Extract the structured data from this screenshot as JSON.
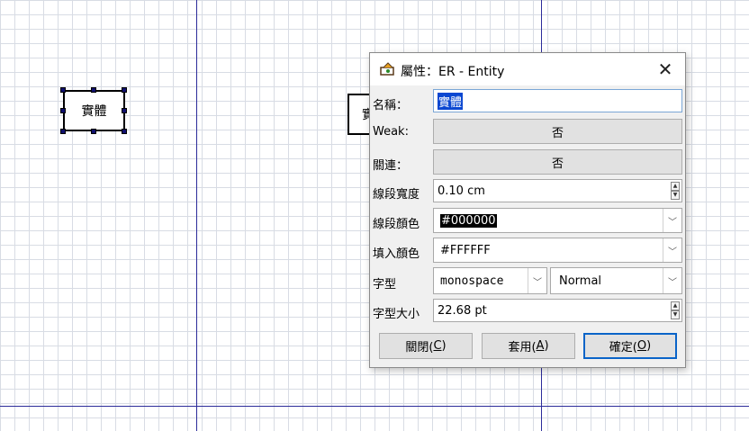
{
  "canvas": {
    "entity_left": {
      "label": "實體"
    },
    "entity_right": {
      "label": "實"
    }
  },
  "dialog": {
    "title": "屬性：ER - Entity",
    "close_icon": "close-icon",
    "rows": {
      "name": {
        "label": "名稱：",
        "value": "實體"
      },
      "weak": {
        "label": "Weak:",
        "value": "否"
      },
      "related": {
        "label": "關連：",
        "value": "否"
      },
      "line_width": {
        "label": "線段寬度",
        "value": "0.10 cm"
      },
      "line_color": {
        "label": "線段顏色",
        "value": "#000000"
      },
      "fill_color": {
        "label": "填入顏色",
        "value": "#FFFFFF"
      },
      "font": {
        "label": "字型",
        "family": "monospace",
        "style": "Normal"
      },
      "font_size": {
        "label": "字型大小",
        "value": "22.68 pt"
      }
    },
    "buttons": {
      "close": {
        "text": "關閉(",
        "key": "C",
        "end": ")"
      },
      "apply": {
        "text": "套用(",
        "key": "A",
        "end": ")"
      },
      "ok": {
        "text": "確定(",
        "key": "O",
        "end": ")"
      }
    }
  }
}
